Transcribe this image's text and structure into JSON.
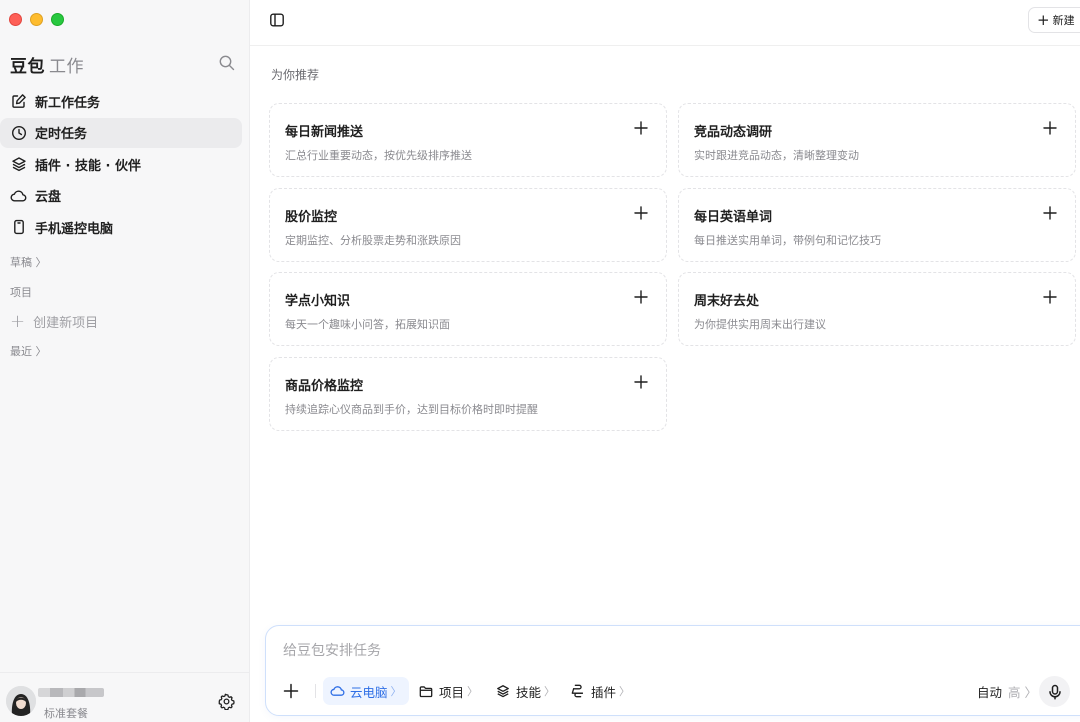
{
  "sidebar": {
    "brand_main": "豆包",
    "brand_sub": "工作",
    "items": [
      {
        "label": "新工作任务",
        "icon": "edit-icon"
      },
      {
        "label": "定时任务",
        "icon": "clock-icon"
      },
      {
        "label": "插件 · 技能 · 伙伴",
        "icon": "layers-icon"
      },
      {
        "label": "云盘",
        "icon": "cloud-icon"
      },
      {
        "label": "手机遥控电脑",
        "icon": "phone-icon"
      }
    ],
    "drafts_label": "草稿 〉",
    "projects_label": "项目",
    "new_project_label": "创建新项目",
    "recent_label": "最近 〉",
    "plan_label": "标准套餐"
  },
  "topbar": {
    "new_label": "新建"
  },
  "main": {
    "section_title": "为你推荐",
    "cards": [
      {
        "title": "每日新闻推送",
        "desc": "汇总行业重要动态，按优先级排序推送"
      },
      {
        "title": "竞品动态调研",
        "desc": "实时跟进竞品动态，清晰整理变动"
      },
      {
        "title": "股价监控",
        "desc": "定期监控、分析股票走势和涨跌原因"
      },
      {
        "title": "每日英语单词",
        "desc": "每日推送实用单词，带例句和记忆技巧"
      },
      {
        "title": "学点小知识",
        "desc": "每天一个趣味小问答，拓展知识面"
      },
      {
        "title": "周末好去处",
        "desc": "为你提供实用周末出行建议"
      },
      {
        "title": "商品价格监控",
        "desc": "持续追踪心仪商品到手价，达到目标价格时即时提醒"
      }
    ]
  },
  "composer": {
    "placeholder": "给豆包安排任务",
    "chips": [
      {
        "label": "云电脑",
        "icon": "cloud-icon"
      },
      {
        "label": "项目",
        "icon": "folder-icon"
      },
      {
        "label": "技能",
        "icon": "layers-icon"
      },
      {
        "label": "插件",
        "icon": "plugin-icon"
      }
    ],
    "chevron": "〉",
    "mode_label": "自动",
    "mode_level": "高 〉"
  },
  "colors": {
    "accent": "#2f6fe6",
    "sidebar_bg": "#f7f7f8",
    "active_item_bg": "#ebebed"
  }
}
